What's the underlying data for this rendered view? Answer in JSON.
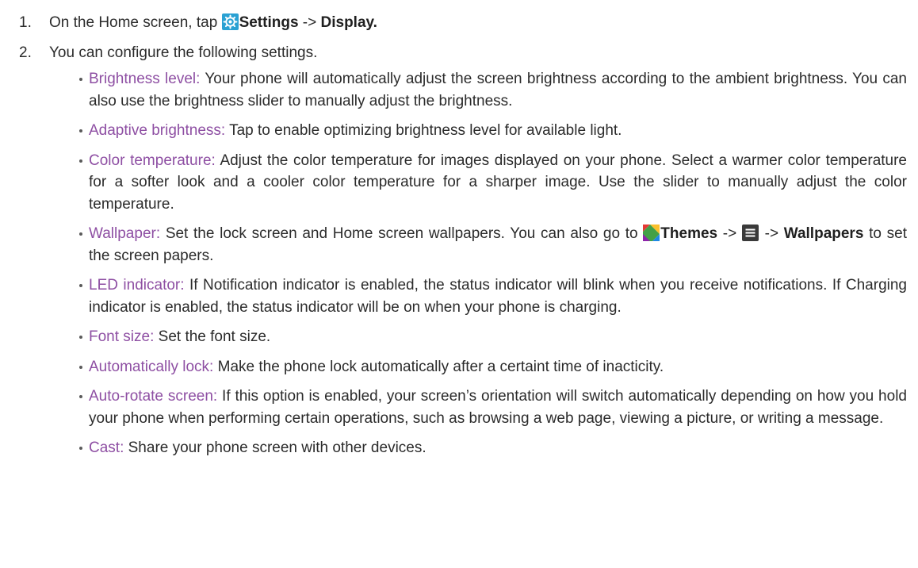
{
  "steps": [
    {
      "number": "1.",
      "prefix": "On the Home screen, tap ",
      "icon": "settings-gear-icon",
      "settings_label": "Settings",
      "arrow": " -> ",
      "display_label": "Display."
    },
    {
      "number": "2.",
      "text": "You can configure the following settings."
    }
  ],
  "items": [
    {
      "term": "Brightness level:",
      "desc": " Your phone will automatically adjust the screen brightness according to the ambient brightness. You can also use the brightness slider to manually adjust the brightness."
    },
    {
      "term": "Adaptive brightness:",
      "desc": " Tap to enable optimizing brightness level for available light."
    },
    {
      "term": "Color temperature:",
      "desc": " Adjust the color temperature for images displayed on your phone. Select a warmer color temperature for a softer look and a cooler color temperature for a sharper image. Use the slider to manually adjust the color temperature."
    },
    {
      "term": "Wallpaper:",
      "desc_before": " Set the lock screen and Home screen wallpapers. You can also go to ",
      "themes_icon": "themes-icon",
      "themes_label": "Themes",
      "arrow1": " -> ",
      "menu_icon": "menu-icon",
      "arrow2": " -> ",
      "wallpapers_label": "Wallpapers",
      "desc_after": " to set the screen papers."
    },
    {
      "term": "LED indicator:",
      "desc": " If Notification indicator is enabled, the status indicator will blink when you receive notifications. If Charging indicator is enabled, the status indicator will be on when your phone is charging."
    },
    {
      "term": "Font size:",
      "desc": " Set the font size."
    },
    {
      "term": "Automatically lock:",
      "desc": " Make the phone lock automatically after a certaint time of inacticity."
    },
    {
      "term": "Auto-rotate screen:",
      "desc": " If this option is enabled, your screen’s orientation will switch automatically depending on how you hold your phone when performing certain operations, such as browsing a web page, viewing a picture, or writing a message."
    },
    {
      "term": "Cast:",
      "desc": " Share your phone screen with other devices."
    }
  ],
  "colors": {
    "term": "#8e4fa3",
    "text": "#2b2b2b",
    "settings_icon_bg": "#2aa1d3",
    "menu_icon_bg": "#3a3a3a"
  }
}
